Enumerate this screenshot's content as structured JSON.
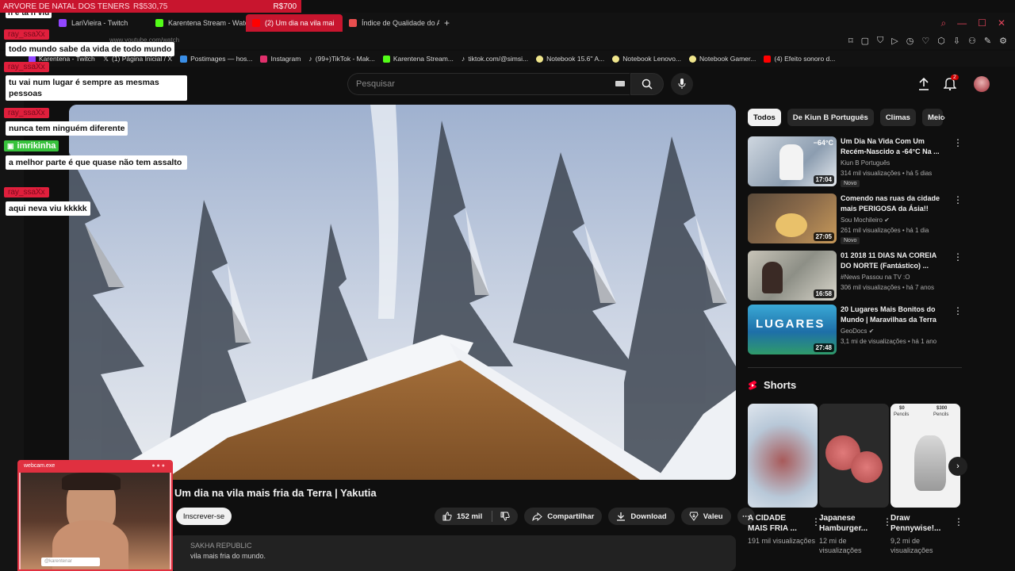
{
  "banner": {
    "left": "ARVORE DE NATAL DOS TENERS",
    "amount": "R$530,75",
    "goal": "R$700"
  },
  "tabs": [
    {
      "label": "LariVieira - Twitch",
      "color": "#9146ff"
    },
    {
      "label": "Karentena Stream - Watc",
      "color": "#53fc18"
    },
    {
      "label": "(2) Um dia na vila mai",
      "color": "#ff0000",
      "active": true
    },
    {
      "label": "Índice de Qualidade do A",
      "color": "#e84e4e"
    }
  ],
  "url": "www.youtube.com/watch",
  "bookmarks": [
    {
      "label": "Karentena - Twitch",
      "color": "#9146ff"
    },
    {
      "label": "(1) Página Inicial / X",
      "color": "#dddddd"
    },
    {
      "label": "Postimages — hos...",
      "color": "#3a8ee6"
    },
    {
      "label": "Instagram",
      "color": "#e1306c"
    },
    {
      "label": "(99+)TikTok - Mak...",
      "color": "#dddddd"
    },
    {
      "label": "Karentena Stream...",
      "color": "#53fc18"
    },
    {
      "label": "tiktok.com/@simsi...",
      "color": "#dddddd"
    },
    {
      "label": "Notebook 15.6'' A...",
      "color": "#f0e68c"
    },
    {
      "label": "Notebook Lenovo...",
      "color": "#f0e68c"
    },
    {
      "label": "Notebook Gamer...",
      "color": "#f0e68c"
    },
    {
      "label": "(4) Efeito sonoro d...",
      "color": "#ff0000"
    }
  ],
  "search": {
    "placeholder": "Pesquisar"
  },
  "notifications": {
    "count": "2"
  },
  "video": {
    "title": "Um dia na vila mais fria da Terra | Yakutia",
    "subscribe": "Inscrever-se",
    "likes": "152 mil",
    "share": "Compartilhar",
    "download": "Download",
    "thanks": "Valeu",
    "desc_hash": "SAKHA REPUBLIC",
    "desc_line": "vila mais fria do mundo."
  },
  "chips": [
    "Todos",
    "De Kiun B Português",
    "Climas",
    "Meio"
  ],
  "recommendations": [
    {
      "title": "Um Dia Na Vida Com Um Recém-Nascido a -64°C Na ...",
      "channel": "Kiun B Português",
      "meta": "314 mil visualizações • há 5 dias",
      "duration": "17:04",
      "badge": "Novo",
      "temp": "−64°C"
    },
    {
      "title": "Comendo nas ruas da cidade mais PERIGOSA da Ásia!!",
      "channel": "Sou Mochileiro ✔",
      "meta": "261 mil visualizações • há 1 dia",
      "duration": "27:05",
      "badge": "Novo"
    },
    {
      "title": "01 2018 11 DIAS NA COREIA DO NORTE (Fantástico) ...",
      "channel": "#News Passou na TV :O",
      "meta": "306 mil visualizações • há 7 anos",
      "duration": "16:58"
    },
    {
      "title": "20 Lugares Mais Bonitos do Mundo | Maravilhas da Terra",
      "channel": "GeoDocs ✔",
      "meta": "3,1 mi de visualizações • há 1 ano",
      "duration": "27:48",
      "overlay": "LUGARES"
    }
  ],
  "shorts": {
    "heading": "Shorts",
    "items": [
      {
        "title": "A CIDADE MAIS FRIA ...",
        "views": "191 mil visualizações"
      },
      {
        "title": "Japanese Hamburger...",
        "views": "12 mi de visualizações"
      },
      {
        "title": "Draw Pennywise!...",
        "views": "9,2 mi de visualizações",
        "p1": "$0",
        "p2": "$300",
        "p3": "Pencils"
      }
    ]
  },
  "chat": {
    "messages": [
      {
        "text": "h e ta n viu"
      },
      {
        "user": "ray_ssaXx"
      },
      {
        "text": "todo mundo sabe da vida de todo mundo"
      },
      {
        "user": "ray_ssaXx"
      },
      {
        "text": "tu vai num lugar é sempre as mesmas pessoas"
      },
      {
        "user": "ray_ssaXx"
      },
      {
        "text": "nunca tem ninguém diferente"
      },
      {
        "user": "imrikinha"
      },
      {
        "text": "a melhor parte é que quase não tem assalto"
      },
      {
        "user": "ray_ssaXx"
      },
      {
        "text": "aqui neva viu kkkkk"
      }
    ]
  },
  "webcam": {
    "title": "webcam.exe",
    "handle": "@karentenar"
  }
}
